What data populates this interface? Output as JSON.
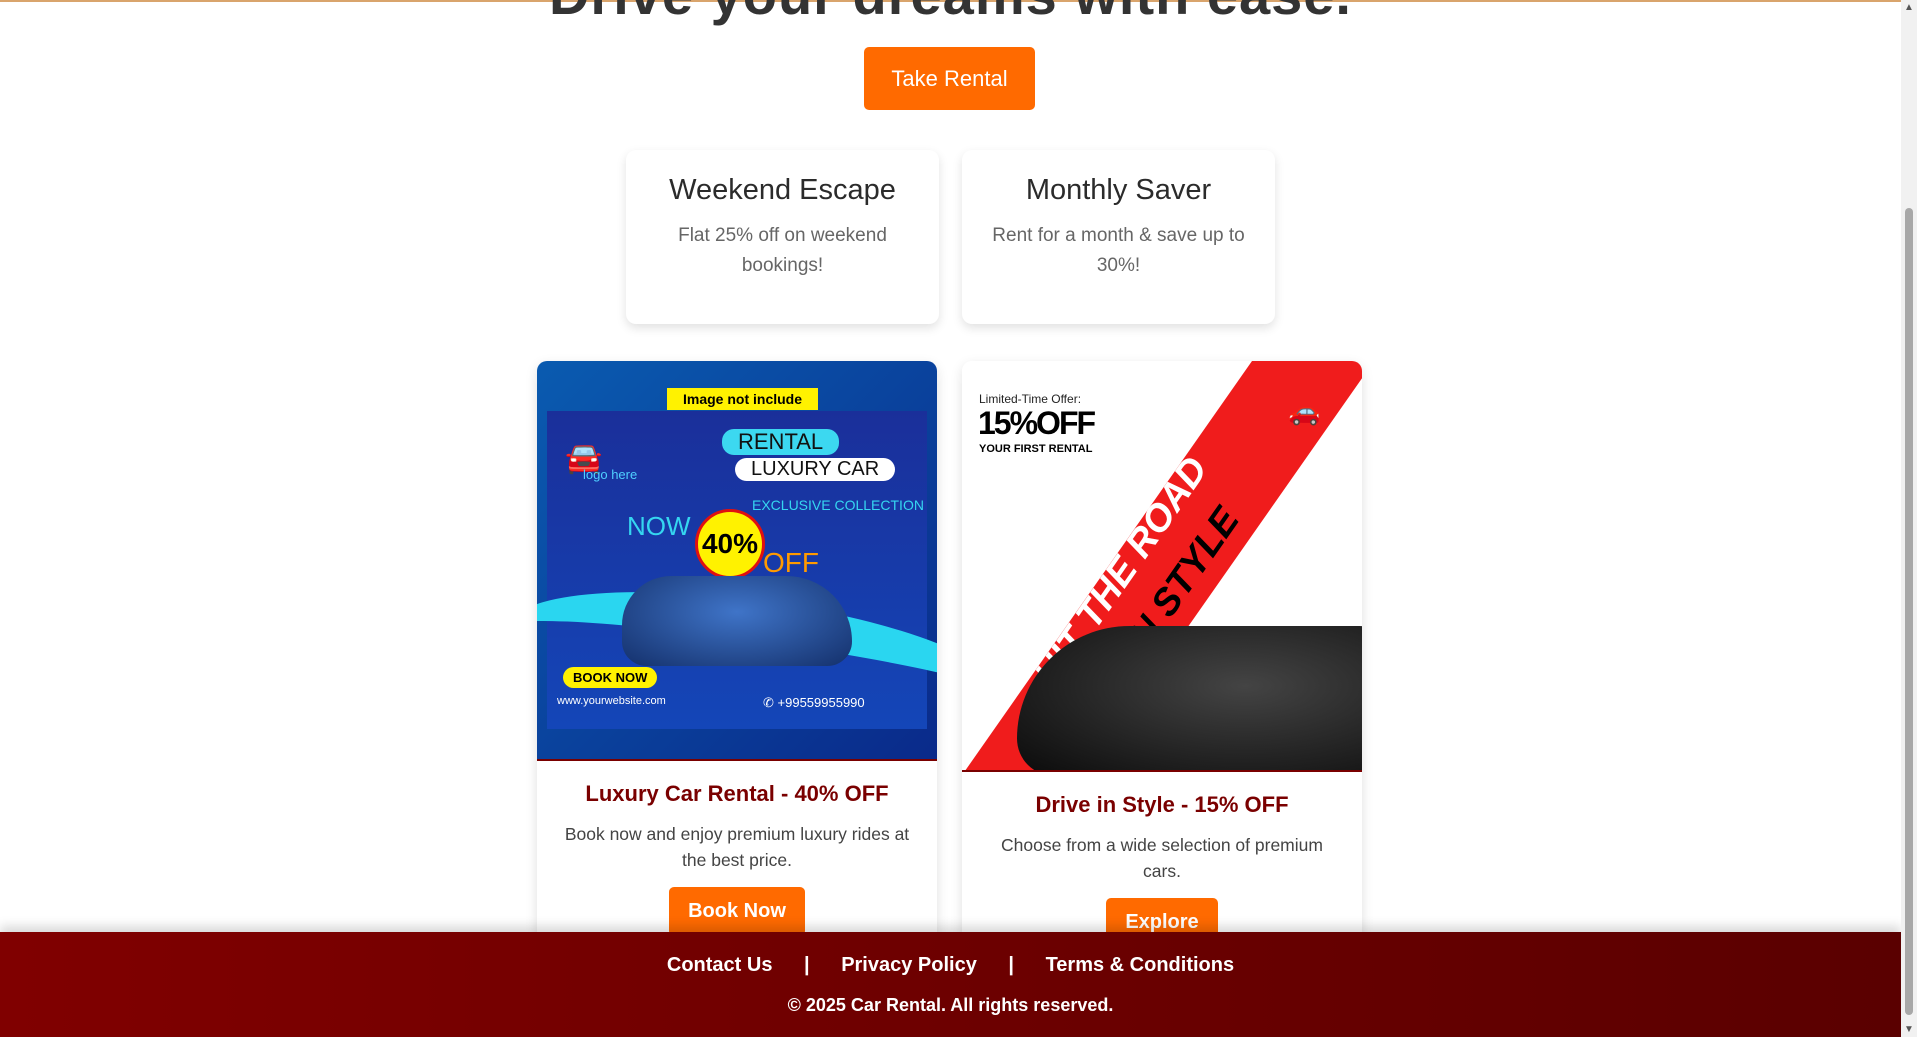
{
  "hero": {
    "title": "Drive your dreams with ease.",
    "button": "Take Rental"
  },
  "offers": [
    {
      "title": "Weekend Escape",
      "desc": "Flat 25% off on weekend bookings!"
    },
    {
      "title": "Monthly Saver",
      "desc": "Rent for a month & save up to 30%!"
    }
  ],
  "ads": [
    {
      "title": "Luxury Car Rental - 40% OFF",
      "desc": "Book now and enjoy premium luxury rides at the best price.",
      "button": "Book Now",
      "image": {
        "tag": "Image not include",
        "rental": "RENTAL",
        "luxury": "LUXURY CAR",
        "logo": "logo here",
        "collection": "EXCLUSIVE COLLECTION",
        "now": "NOW",
        "pct": "40%",
        "off": "OFF",
        "book": "BOOK NOW",
        "site": "www.yourwebsite.com",
        "phone": "+99559955990"
      }
    },
    {
      "title": "Drive in Style - 15% OFF",
      "desc": "Choose from a wide selection of premium cars.",
      "button": "Explore",
      "image": {
        "limited": "Limited-Time Offer:",
        "pct": "15%OFF",
        "first": "YOUR FIRST RENTAL",
        "road": "HIT THE ROAD",
        "style": "IN STYLE"
      }
    }
  ],
  "footer": {
    "links": [
      "Contact Us",
      "Privacy Policy",
      "Terms & Conditions"
    ],
    "separator": "|",
    "copyright": "© 2025 Car Rental. All rights reserved."
  },
  "colors": {
    "accent": "#ff6a00",
    "brand": "#7a0000"
  }
}
